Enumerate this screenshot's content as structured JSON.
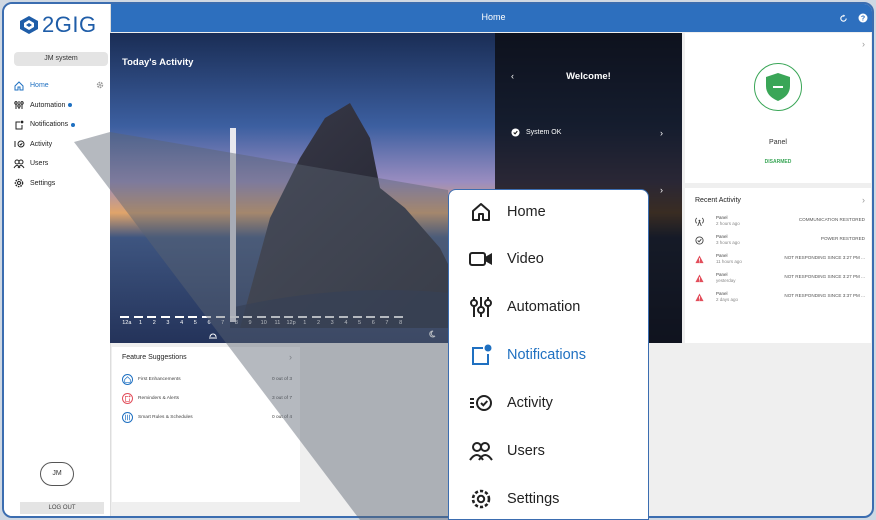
{
  "app": {
    "brand": "2GIG",
    "page_title": "Home"
  },
  "sidebar": {
    "user_label": "JM   system",
    "items": [
      {
        "label": "Home",
        "icon": "home-icon",
        "active": true,
        "dot": false
      },
      {
        "label": "Automation",
        "icon": "automation-icon",
        "active": false,
        "dot": true
      },
      {
        "label": "Notifications",
        "icon": "notifications-icon",
        "active": false,
        "dot": true
      },
      {
        "label": "Activity",
        "icon": "activity-icon",
        "active": false,
        "dot": false
      },
      {
        "label": "Users",
        "icon": "users-icon",
        "active": false,
        "dot": false
      },
      {
        "label": "Settings",
        "icon": "settings-icon",
        "active": false,
        "dot": false
      }
    ],
    "avatar_initials": "JM",
    "logout_label": "LOG OUT"
  },
  "hero": {
    "title": "Today's Activity",
    "hours": [
      "12a",
      "1",
      "2",
      "3",
      "4",
      "5",
      "6",
      "7",
      "8",
      "9",
      "10",
      "11",
      "12p",
      "1",
      "2",
      "3",
      "4",
      "5",
      "6",
      "7",
      "8"
    ]
  },
  "welcome": {
    "title": "Welcome!",
    "status": "System OK"
  },
  "panel_card": {
    "label": "Panel",
    "status": "DISARMED",
    "status_color": "#3aa657"
  },
  "recent_activity": {
    "title": "Recent Activity",
    "rows": [
      {
        "source": "Panel",
        "time": "2 hours ago",
        "message": "COMMUNICATION RESTORED",
        "icon": "antenna-icon"
      },
      {
        "source": "Panel",
        "time": "3 hours ago",
        "message": "POWER RESTORED",
        "icon": "check-circle-icon"
      },
      {
        "source": "Panel",
        "time": "11 hours ago",
        "message": "NOT RESPONDING SINCE 3:27 PM ...",
        "icon": "warning-icon"
      },
      {
        "source": "Panel",
        "time": "yesterday",
        "message": "NOT RESPONDING SINCE 3:27 PM ...",
        "icon": "warning-icon"
      },
      {
        "source": "Panel",
        "time": "2 days ago",
        "message": "NOT RESPONDING SINCE 3:37 PM ...",
        "icon": "warning-icon"
      }
    ]
  },
  "features": {
    "title": "Feature Suggestions",
    "rows": [
      {
        "label": "First Enhancements",
        "progress": "0 out of 3"
      },
      {
        "label": "Reminders & Alerts",
        "progress": "3 out of 7"
      },
      {
        "label": "Smart Rules & Schedules",
        "progress": "0 out of 4"
      }
    ]
  },
  "zoom_menu": {
    "items": [
      {
        "label": "Home",
        "icon": "home-icon"
      },
      {
        "label": "Video",
        "icon": "video-icon"
      },
      {
        "label": "Automation",
        "icon": "automation-icon"
      },
      {
        "label": "Notifications",
        "icon": "notifications-icon",
        "highlight": true
      },
      {
        "label": "Activity",
        "icon": "activity-icon"
      },
      {
        "label": "Users",
        "icon": "users-icon"
      },
      {
        "label": "Settings",
        "icon": "settings-icon"
      }
    ]
  },
  "colors": {
    "brand_blue": "#2d6fbe",
    "accent_blue": "#1f70c1",
    "ok_green": "#3aa657",
    "alert_red": "#e24e5b"
  }
}
